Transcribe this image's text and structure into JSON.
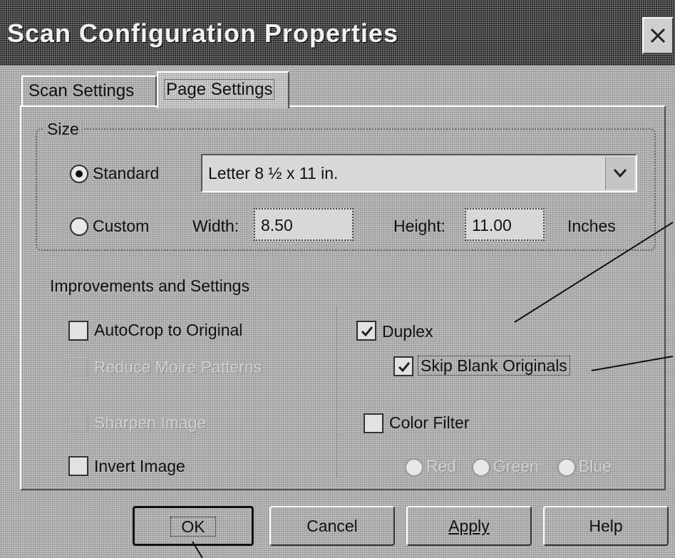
{
  "window": {
    "title": "Scan Configuration Properties"
  },
  "tabs": [
    {
      "label": "Scan Settings",
      "selected": false
    },
    {
      "label": "Page Settings",
      "selected": true
    }
  ],
  "size_group": {
    "label": "Size",
    "standard_label": "Standard",
    "standard_selected": true,
    "standard_value": "Letter 8 ½ x 11 in.",
    "custom_label": "Custom",
    "width_label": "Width:",
    "width_value": "8.50",
    "height_label": "Height:",
    "height_value": "11.00",
    "units_label": "Inches"
  },
  "improvements": {
    "label": "Improvements and Settings",
    "autocrop": {
      "label": "AutoCrop to Original",
      "checked": false,
      "enabled": true
    },
    "reduce_moire": {
      "label": "Reduce Moire Patterns",
      "checked": false,
      "enabled": false
    },
    "sharpen": {
      "label": "Sharpen Image",
      "checked": false,
      "enabled": false
    },
    "invert": {
      "label": "Invert Image",
      "checked": false,
      "enabled": true
    },
    "duplex": {
      "label": "Duplex",
      "checked": true,
      "enabled": true
    },
    "skip_blank": {
      "label": "Skip Blank Originals",
      "checked": true,
      "enabled": true
    },
    "color_filter": {
      "label": "Color Filter",
      "checked": false,
      "enabled": true
    },
    "filter_options": [
      "Red",
      "Green",
      "Blue"
    ]
  },
  "buttons": {
    "ok": "OK",
    "cancel": "Cancel",
    "apply": "Apply",
    "help": "Help"
  },
  "colors": {
    "dialog_bg": "#bdbdbd",
    "titlebar_bg": "#2b2b2b",
    "title_text": "#f2f2f2"
  }
}
